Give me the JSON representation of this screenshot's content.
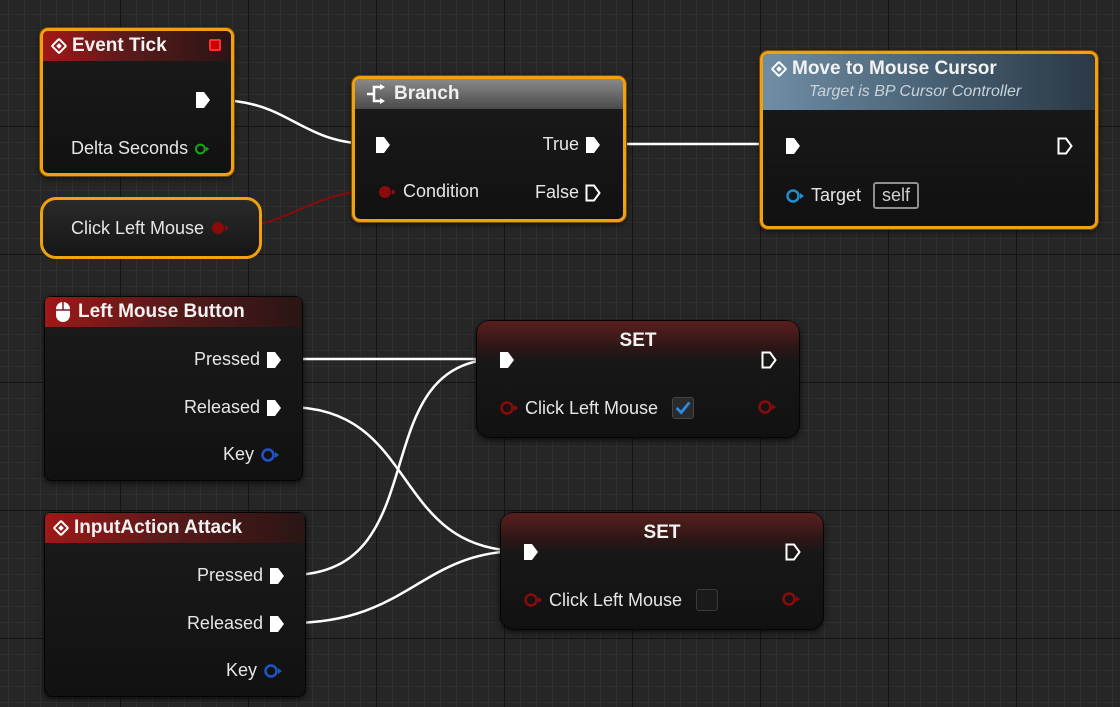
{
  "event_tick": {
    "title": "Event Tick",
    "delta_seconds_label": "Delta Seconds"
  },
  "branch": {
    "title": "Branch",
    "condition_label": "Condition",
    "true_label": "True",
    "false_label": "False"
  },
  "move_to_cursor": {
    "title": "Move to Mouse Cursor",
    "subtitle": "Target is BP Cursor Controller",
    "target_label": "Target",
    "target_value": "self"
  },
  "click_left_mouse_var": {
    "label": "Click Left Mouse"
  },
  "left_mouse_button": {
    "title": "Left Mouse Button",
    "pressed_label": "Pressed",
    "released_label": "Released",
    "key_label": "Key"
  },
  "input_action_attack": {
    "title": "InputAction Attack",
    "pressed_label": "Pressed",
    "released_label": "Released",
    "key_label": "Key"
  },
  "set_true": {
    "title": "SET",
    "var_label": "Click Left Mouse",
    "checked": true
  },
  "set_false": {
    "title": "SET",
    "var_label": "Click Left Mouse",
    "checked": false
  },
  "colors": {
    "selected_border": "#f0a10d",
    "exec_wire": "#ffffff",
    "bool_wire": "#8b0b0b",
    "bool_pin": "#8b0b0b",
    "float_pin": "#19a619",
    "object_pin": "#1d8fd1",
    "key_pin": "#1e55c8",
    "check_blue": "#2b8be6"
  },
  "icons": {
    "event_tick": "event-diamond-icon",
    "branch": "branch-icon",
    "move_to_cursor": "function-diamond-icon",
    "left_mouse_button": "mouse-icon",
    "input_action_attack": "event-diamond-icon",
    "event_stop": "red-square-icon",
    "check": "checkmark-icon"
  }
}
